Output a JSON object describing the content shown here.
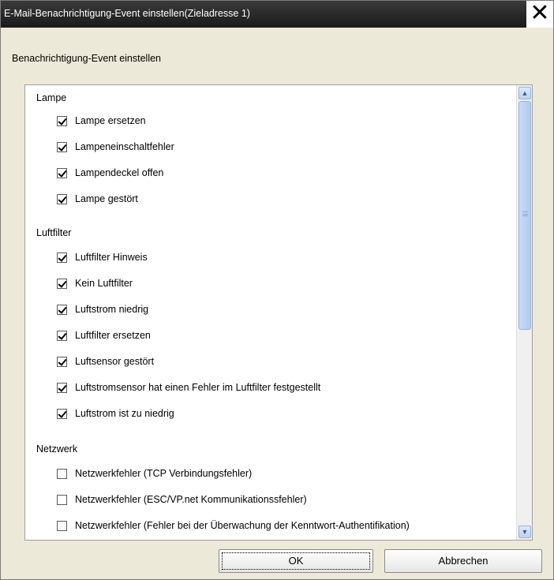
{
  "window": {
    "title": "E-Mail-Benachrichtigung-Event einstellen(Zieladresse 1)",
    "close_symbol": "✕"
  },
  "dialog": {
    "subtitle": "Benachrichtigung-Event einstellen"
  },
  "groups": [
    {
      "label": "Lampe",
      "items": [
        {
          "label": "Lampe ersetzen",
          "checked": true
        },
        {
          "label": "Lampeneinschaltfehler",
          "checked": true
        },
        {
          "label": "Lampendeckel offen",
          "checked": true
        },
        {
          "label": "Lampe gestört",
          "checked": true
        }
      ]
    },
    {
      "label": "Luftfilter",
      "items": [
        {
          "label": "Luftfilter Hinweis",
          "checked": true
        },
        {
          "label": "Kein Luftfilter",
          "checked": true
        },
        {
          "label": "Luftstrom niedrig",
          "checked": true
        },
        {
          "label": "Luftfilter ersetzen",
          "checked": true
        },
        {
          "label": "Luftsensor gestört",
          "checked": true
        },
        {
          "label": "Luftstromsensor hat einen Fehler im Luftfilter festgestellt",
          "checked": true
        },
        {
          "label": "Luftstrom ist zu niedrig",
          "checked": true
        }
      ]
    },
    {
      "label": "Netzwerk",
      "items": [
        {
          "label": "Netzwerkfehler (TCP Verbindungsfehler)",
          "checked": false
        },
        {
          "label": "Netzwerkfehler (ESC/VP.net Kommunikationssfehler)",
          "checked": false
        },
        {
          "label": "Netzwerkfehler (Fehler bei der Überwachung der Kenntwort-Authentifikation)",
          "checked": false
        }
      ]
    }
  ],
  "buttons": {
    "ok": "OK",
    "cancel": "Abbrechen"
  },
  "icons": {
    "close": "close-icon",
    "scroll_up": "scroll-up-arrow-icon",
    "scroll_down": "scroll-down-arrow-icon",
    "checkbox": "checkbox-icon"
  }
}
